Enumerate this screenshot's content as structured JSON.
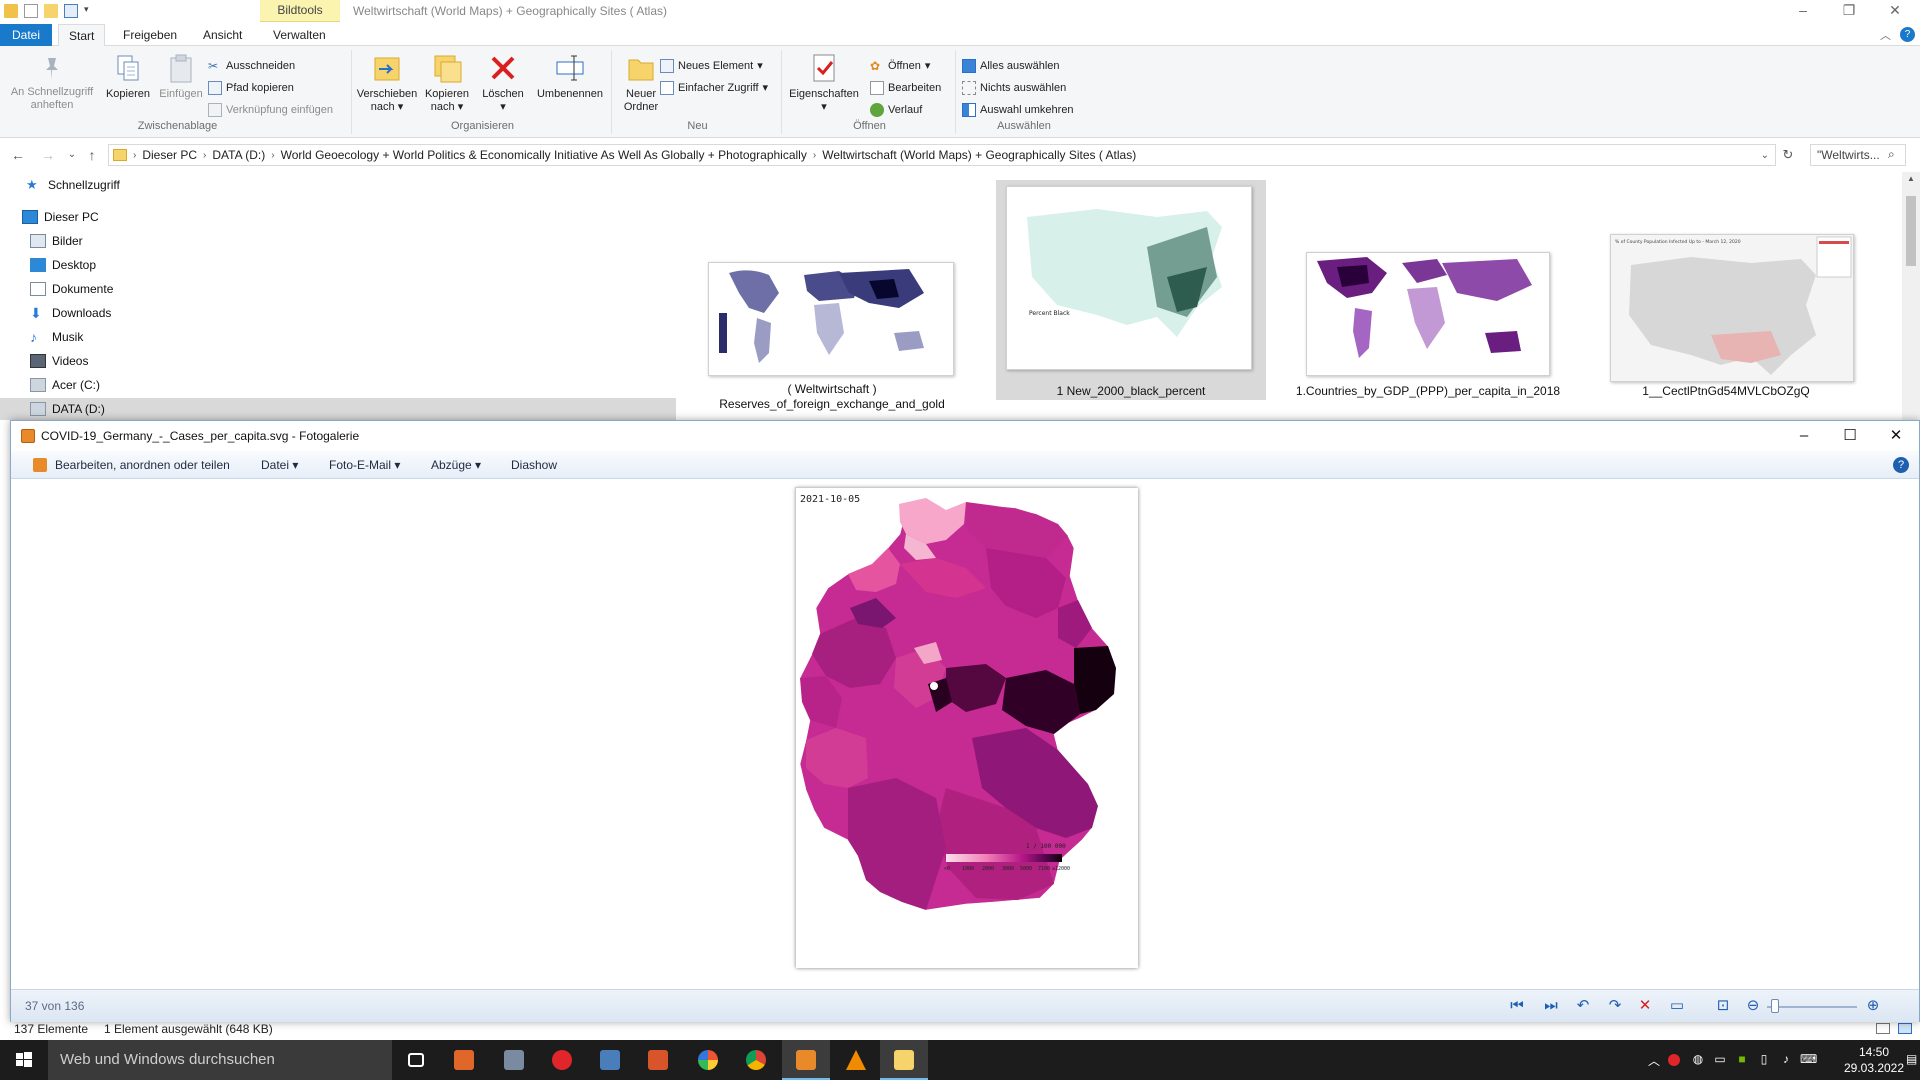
{
  "explorer": {
    "window_title": "Weltwirtschaft (World Maps) + Geographically Sites ( Atlas)",
    "contextual_tab": "Bildtools",
    "tabs": [
      "Datei",
      "Start",
      "Freigeben",
      "Ansicht",
      "Verwalten"
    ],
    "ribbon": {
      "clipboard": {
        "label": "Zwischenablage",
        "pin": "An Schnellzugriff anheften",
        "copy": "Kopieren",
        "paste": "Einfügen",
        "cut": "Ausschneiden",
        "copy_path": "Pfad kopieren",
        "paste_shortcut": "Verknüpfung einfügen"
      },
      "organize": {
        "label": "Organisieren",
        "move_to": "Verschieben nach",
        "copy_to": "Kopieren nach",
        "delete": "Löschen",
        "rename": "Umbenennen"
      },
      "new": {
        "label": "Neu",
        "new_folder": "Neuer Ordner",
        "new_item": "Neues Element",
        "easy_access": "Einfacher Zugriff"
      },
      "open": {
        "label": "Öffnen",
        "properties": "Eigenschaften",
        "open": "Öffnen",
        "edit": "Bearbeiten",
        "history": "Verlauf"
      },
      "select": {
        "label": "Auswählen",
        "select_all": "Alles auswählen",
        "select_none": "Nichts auswählen",
        "invert": "Auswahl umkehren"
      }
    },
    "breadcrumbs": [
      "Dieser PC",
      "DATA (D:)",
      "World Geoecology + World Politics & Economically Initiative As Well As Globally + Photographically",
      "Weltwirtschaft (World Maps) + Geographically Sites ( Atlas)"
    ],
    "search_placeholder": "\"Weltwirts...",
    "nav": [
      "Schnellzugriff",
      "Dieser PC",
      "Bilder",
      "Desktop",
      "Dokumente",
      "Downloads",
      "Musik",
      "Videos",
      "Acer (C:)",
      "DATA (D:)"
    ],
    "files": [
      {
        "name": "( Weltwirtschaft ) Reserves_of_foreign_exchange_and_gold",
        "line1": "( Weltwirtschaft )",
        "line2": "Reserves_of_foreign_exchange_and_gold"
      },
      {
        "name": "1 New_2000_black_percent",
        "line1": "1 New_2000_black_percent",
        "line2": ""
      },
      {
        "name": "1.Countries_by_GDP_(PPP)_per_capita_in_2018",
        "line1": "1.Countries_by_GDP_(PPP)_per_capita_in_2018",
        "line2": ""
      },
      {
        "name": "1__CectlPtnGd54MVLCbOZgQ",
        "line1": "1__CectlPtnGd54MVLCbOZgQ",
        "line2": ""
      }
    ],
    "thumb_text": {
      "black_percent_legend_title": "Percent Black",
      "county_chart_title": "% of County Population Infected Up to - March 12, 2020"
    },
    "status": {
      "count": "137 Elemente",
      "selected": "1 Element ausgewählt (648 KB)"
    }
  },
  "gallery": {
    "title": "COVID-19_Germany_-_Cases_per_capita.svg - Fotogalerie",
    "toolbar": {
      "edit": "Bearbeiten, anordnen oder teilen",
      "file": "Datei",
      "email": "Foto-E-Mail",
      "prints": "Abzüge",
      "slideshow": "Diashow"
    },
    "image": {
      "date": "2021-10-05",
      "legend_unit": "1 / 100 000",
      "legend_ticks": [
        "<0",
        "1000",
        "2000",
        "3000",
        "5000",
        "7100",
        "≥12000"
      ]
    },
    "position": "37 von 136"
  },
  "taskbar": {
    "search_placeholder": "Web und Windows durchsuchen",
    "time": "14:50",
    "date": "29.03.2022"
  },
  "colors": {
    "file_tab": "#1979ca",
    "bildtools": "#fbf3b0",
    "taskbar": "#1c1c1c",
    "map_light": "#fbc9dc",
    "map_mid": "#c0248e",
    "map_dark": "#1a0016"
  }
}
